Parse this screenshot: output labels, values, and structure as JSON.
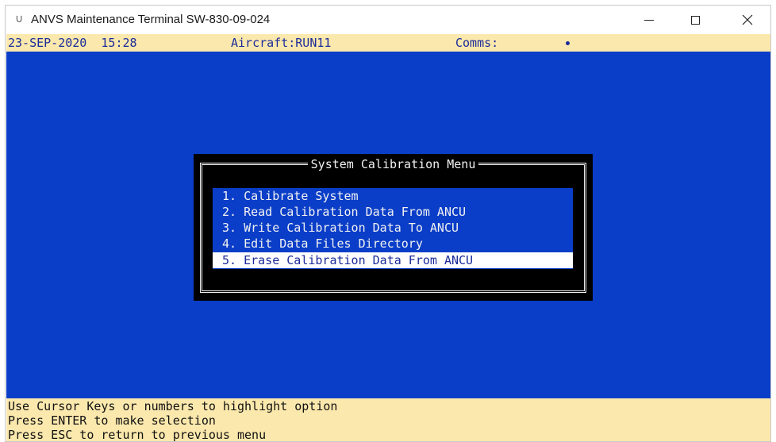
{
  "window": {
    "title": "ANVS Maintenance Terminal SW-830-09-024",
    "icon": "app-icon",
    "controls": [
      "minimize-icon",
      "maximize-icon",
      "close-icon"
    ]
  },
  "status": {
    "date": "23-SEP-2020",
    "time": "15:28",
    "aircraft": "Aircraft:RUN11",
    "comms_label": "Comms:",
    "comms_indicator": "•"
  },
  "menu": {
    "title": "System Calibration Menu",
    "items": [
      {
        "label": "1. Calibrate System"
      },
      {
        "label": "2. Read Calibration Data From ANCU"
      },
      {
        "label": "3. Write Calibration Data To ANCU"
      },
      {
        "label": "4. Edit Data Files Directory"
      },
      {
        "label": "5. Erase Calibration Data From ANCU"
      }
    ],
    "selected_index": 4
  },
  "help": {
    "lines": [
      "Use Cursor Keys or numbers to highlight option",
      "Press ENTER to make selection",
      "Press ESC to return to previous menu"
    ]
  },
  "colors": {
    "terminal_background": "#0a3ec8",
    "status_background": "#fbe8ad",
    "status_text": "#1b2b9a",
    "dialog_background": "#000000",
    "highlight_background": "#ffffff"
  }
}
